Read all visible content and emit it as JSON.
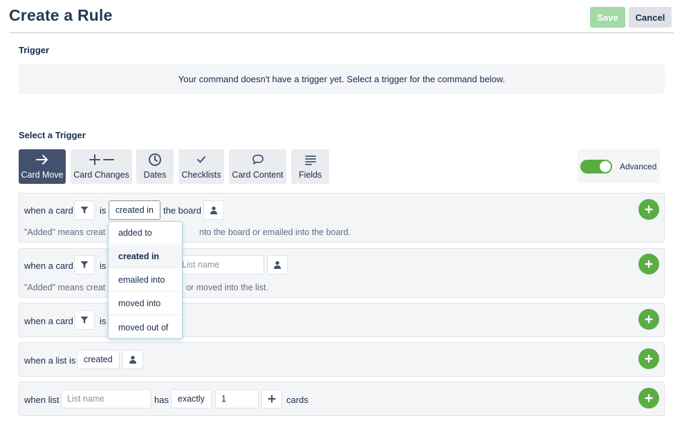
{
  "header": {
    "title": "Create a Rule",
    "save_label": "Save",
    "cancel_label": "Cancel"
  },
  "trigger": {
    "heading": "Trigger",
    "empty_message": "Your command doesn't have a trigger yet. Select a trigger for the command below."
  },
  "select_trigger": {
    "heading": "Select a Trigger",
    "tabs": [
      {
        "label": "Card Move",
        "icon": "arrow-right-icon",
        "active": true
      },
      {
        "label": "Card Changes",
        "icon": "plus-minus-icon",
        "active": false
      },
      {
        "label": "Dates",
        "icon": "clock-icon",
        "active": false
      },
      {
        "label": "Checklists",
        "icon": "checkmark-icon",
        "active": false
      },
      {
        "label": "Card Content",
        "icon": "comment-icon",
        "active": false
      },
      {
        "label": "Fields",
        "icon": "lines-icon",
        "active": false
      }
    ],
    "advanced": {
      "label": "Advanced",
      "enabled": true
    }
  },
  "rules": [
    {
      "prefix": "when a card",
      "is": "is",
      "action_value": "created in",
      "suffix": "the board",
      "hint_left": "\"Added\" means creat",
      "hint_right": "nto the board or emailed into the board."
    },
    {
      "prefix": "when a card",
      "is": "is",
      "list_placeholder": "List name",
      "hint_left": "\"Added\" means creat",
      "hint_right": "or moved into the list."
    },
    {
      "prefix": "when a card",
      "is": "is"
    },
    {
      "prefix": "when a list is",
      "action_value": "created"
    },
    {
      "prefix": "when list",
      "list_placeholder": "List name",
      "has": "has",
      "comparator": "exactly",
      "count_value": "1",
      "suffix": "cards"
    }
  ],
  "dropdown": {
    "options": [
      "added to",
      "created in",
      "emailed into",
      "moved into",
      "moved out of"
    ],
    "selected": "created in"
  },
  "colors": {
    "accent_green": "#5aac44",
    "save_disabled": "#a3d9a5",
    "active_tab": "#42526e",
    "title": "#1f3a56"
  }
}
